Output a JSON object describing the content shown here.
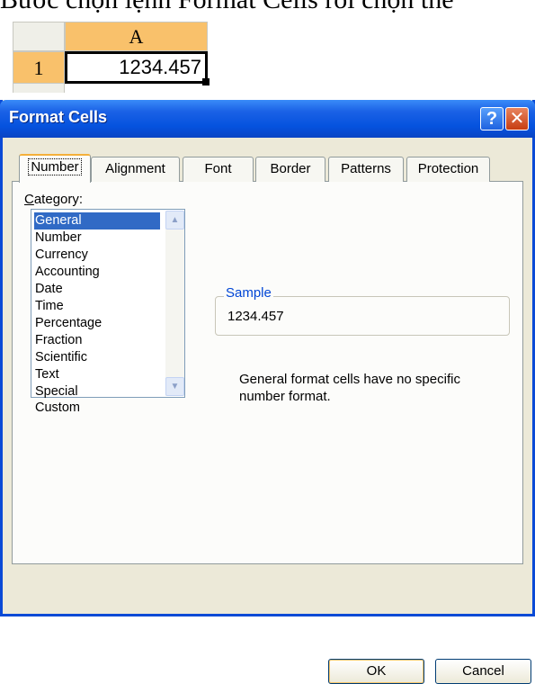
{
  "caption": {
    "text": "Bước chọn lệnh Format Cells rồi chọn thẻ"
  },
  "spreadsheet": {
    "column_header": "A",
    "row_header": "1",
    "cell_value": "1234.457"
  },
  "dialog": {
    "title": "Format Cells",
    "help_glyph": "?",
    "close_glyph": "✕",
    "tabs": [
      {
        "label": "Number",
        "active": true
      },
      {
        "label": "Alignment",
        "active": false
      },
      {
        "label": "Font",
        "active": false
      },
      {
        "label": "Border",
        "active": false
      },
      {
        "label": "Patterns",
        "active": false
      },
      {
        "label": "Protection",
        "active": false
      }
    ],
    "category_label_accel": "C",
    "category_label_rest": "ategory:",
    "categories": [
      "General",
      "Number",
      "Currency",
      "Accounting",
      "Date",
      "Time",
      "Percentage",
      "Fraction",
      "Scientific",
      "Text",
      "Special",
      "Custom"
    ],
    "selected_category": "General",
    "sample": {
      "legend": "Sample",
      "value": "1234.457"
    },
    "description": "General format cells have no specific number format.",
    "ok_label": "OK",
    "cancel_label": "Cancel"
  },
  "colors": {
    "selection": "#316ac5",
    "titlebar": "#0552de",
    "header_highlight": "#f9c16b"
  }
}
